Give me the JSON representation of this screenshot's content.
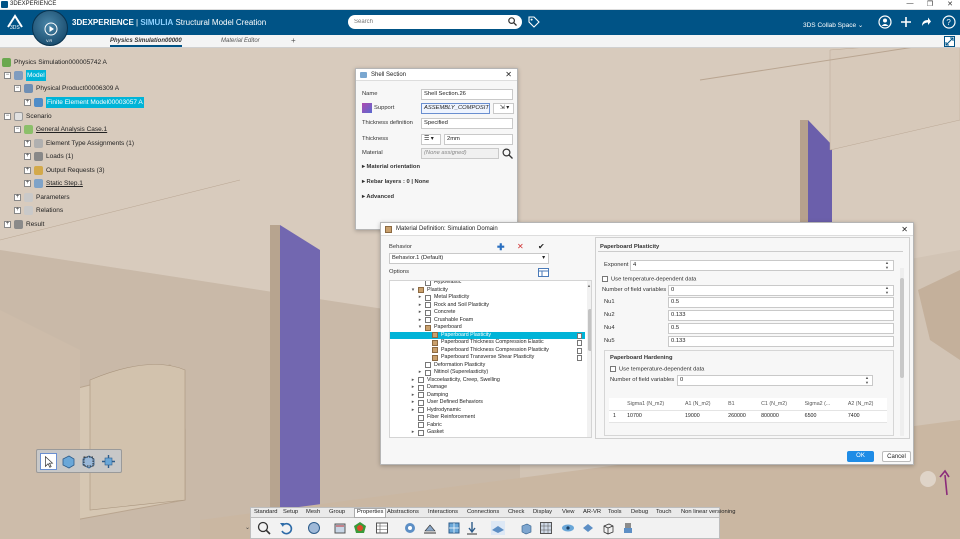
{
  "window": {
    "title": "3DEXPERIENCE",
    "controls": [
      "—",
      "❐",
      "✕"
    ]
  },
  "topbar": {
    "brand": "3DEXPERIENCE",
    "brand_app": "SIMULIA",
    "app_title": "Structural Model Creation",
    "search_placeholder": "Search",
    "collab_space": "3DS Collab Space",
    "compass_version": "V.R"
  },
  "tabs": [
    {
      "label": "Physics Simulation00000",
      "active": true
    },
    {
      "label": "Material Editor",
      "active": false
    },
    {
      "label": "+",
      "active": false
    }
  ],
  "tree": {
    "root": "Physics Simulation000005742 A",
    "model": "Model",
    "physical_product": "Physical Product00006309 A",
    "fem": "Finite Element Model00003057 A",
    "scenario": "Scenario",
    "analysis_case": "General Analysis Case.1",
    "element_type": "Element Type Assignments (1)",
    "loads": "Loads (1)",
    "output_requests": "Output Requests (3)",
    "static_step": "Static Step.1",
    "parameters": "Parameters",
    "relations": "Relations",
    "result": "Result"
  },
  "shell_section": {
    "title": "Shell Section",
    "name_label": "Name",
    "name_value": "Shell Section.26",
    "support_label": "Support",
    "support_value": "ASSEMBLY_COMPOSITE_",
    "thickness_def_label": "Thickness definition",
    "thickness_def_value": "Specified",
    "thickness_label": "Thickness",
    "thickness_value": "2mm",
    "material_label": "Material",
    "material_value": "(None assigned)",
    "material_orientation": "Material orientation",
    "rebar_layers": "Rebar layers : 0 | None",
    "advanced": "Advanced"
  },
  "material_dialog": {
    "title": "Material Definition: Simulation Domain",
    "behavior_label": "Behavior",
    "behavior_value": "Behavior.1 (Default)",
    "options_label": "Options",
    "tree_items": [
      {
        "label": "Hypoelastic",
        "level": 1,
        "arrow": "",
        "checked": false
      },
      {
        "label": "Plasticity",
        "level": 0,
        "arrow": "▾",
        "checked": true
      },
      {
        "label": "Metal Plasticity",
        "level": 1,
        "arrow": "▸",
        "checked": false
      },
      {
        "label": "Rock and Soil Plasticity",
        "level": 1,
        "arrow": "▸",
        "checked": false
      },
      {
        "label": "Concrete",
        "level": 1,
        "arrow": "▸",
        "checked": false
      },
      {
        "label": "Crushable Foam",
        "level": 1,
        "arrow": "▸",
        "checked": false
      },
      {
        "label": "Paperboard",
        "level": 1,
        "arrow": "▾",
        "checked": true
      },
      {
        "label": "Paperboard Plasticity",
        "level": 2,
        "arrow": "",
        "checked": true,
        "selected": true
      },
      {
        "label": "Paperboard Thickness Compression Elastic",
        "level": 2,
        "arrow": "",
        "checked": true
      },
      {
        "label": "Paperboard Thickness Compression Plasticity",
        "level": 2,
        "arrow": "",
        "checked": true
      },
      {
        "label": "Paperboard Transverse Shear Plasticity",
        "level": 2,
        "arrow": "",
        "checked": true
      },
      {
        "label": "Deformation Plasticity",
        "level": 1,
        "arrow": "",
        "checked": false
      },
      {
        "label": "Nitinol (Superelasticity)",
        "level": 1,
        "arrow": "▸",
        "checked": false
      },
      {
        "label": "Viscoelasticity, Creep, Swelling",
        "level": 0,
        "arrow": "▸",
        "checked": false
      },
      {
        "label": "Damage",
        "level": 0,
        "arrow": "▸",
        "checked": false
      },
      {
        "label": "Damping",
        "level": 0,
        "arrow": "▸",
        "checked": false
      },
      {
        "label": "User Defined Behaviors",
        "level": 0,
        "arrow": "▸",
        "checked": false
      },
      {
        "label": "Hydrodynamic",
        "level": 0,
        "arrow": "▸",
        "checked": false
      },
      {
        "label": "Fiber Reinforcement",
        "level": 0,
        "arrow": "",
        "checked": false
      },
      {
        "label": "Fabric",
        "level": 0,
        "arrow": "",
        "checked": false
      },
      {
        "label": "Gasket",
        "level": 0,
        "arrow": "▸",
        "checked": false
      }
    ],
    "plasticity": {
      "section": "Paperboard Plasticity",
      "exponent_label": "Exponent",
      "exponent_value": "4",
      "temp_dep": "Use temperature-dependent data",
      "field_vars_label": "Number of field variables",
      "field_vars_value": "0",
      "nu": [
        {
          "label": "Nu1",
          "value": "0.5"
        },
        {
          "label": "Nu2",
          "value": "0.133"
        },
        {
          "label": "Nu4",
          "value": "0.5"
        },
        {
          "label": "Nu5",
          "value": "0.133"
        }
      ]
    },
    "hardening": {
      "section": "Paperboard Hardening",
      "temp_dep": "Use temperature-dependent data",
      "field_vars_label": "Number of field variables",
      "field_vars_value": "0",
      "columns": [
        "",
        "Sigma1 (N_m2)",
        "A1 (N_m2)",
        "B1",
        "C1 (N_m2)",
        "Sigma2 (...",
        "A2 (N_m2)"
      ],
      "rows": [
        [
          "1",
          "10700",
          "19000",
          "260000",
          "800000",
          "6500",
          "7400"
        ]
      ]
    },
    "ok": "OK",
    "cancel": "Cancel"
  },
  "action_bar": {
    "tabs": [
      "Standard",
      "Setup",
      "Mesh",
      "Group",
      "Properties",
      "Abstractions",
      "Interactions",
      "Connections",
      "Check",
      "Display",
      "View",
      "AR-VR",
      "Tools",
      "Debug",
      "Touch",
      "Non linear versioning"
    ],
    "active": "Properties"
  },
  "colors": {
    "topbar": "#005386",
    "selection": "#00b4d8",
    "ok_button": "#1f8ce6",
    "purple_wall": "#6a5aa8",
    "background": "#cfc3b6"
  }
}
